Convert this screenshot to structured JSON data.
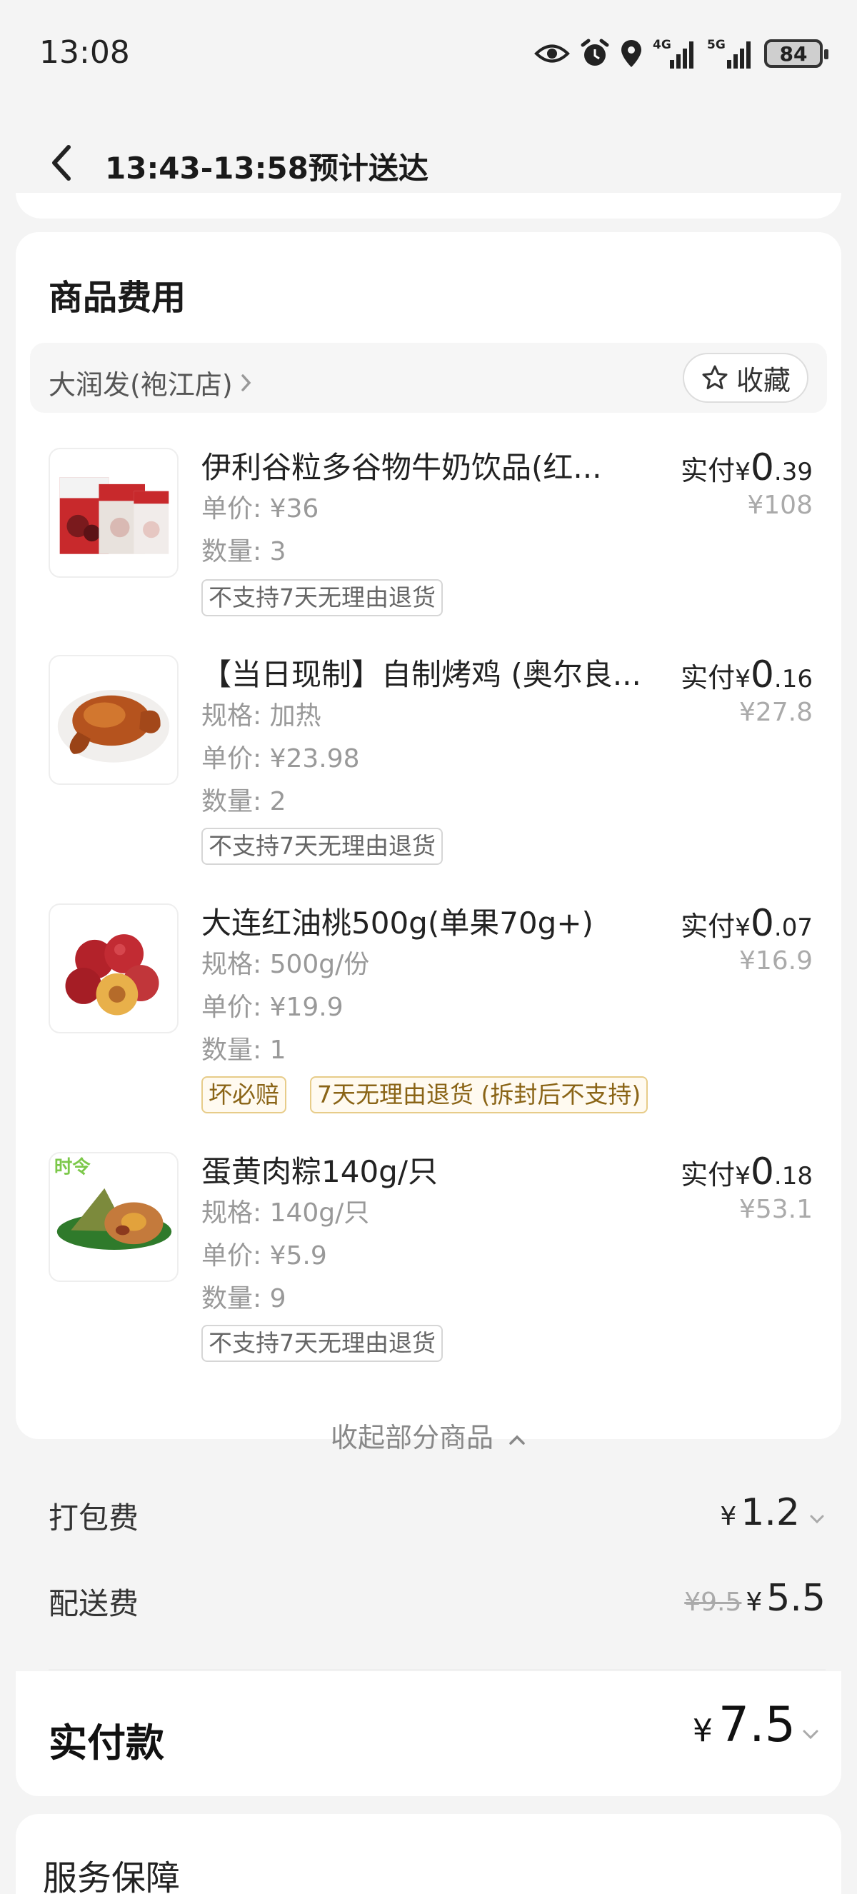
{
  "status_bar": {
    "time": "13:08",
    "battery": "84",
    "signal_labels": [
      "4G",
      "5G"
    ]
  },
  "nav": {
    "title": "13:43-13:58预计送达"
  },
  "fees_card": {
    "title": "商品费用",
    "store": {
      "name": "大润发(袍江店)",
      "favorite_label": "收藏"
    },
    "items": [
      {
        "name": "伊利谷粒多谷物牛奶饮品(红...",
        "meta": [
          "单价: ¥36",
          "数量: 3"
        ],
        "tags": [
          {
            "text": "不支持7天无理由退货",
            "style": "gray"
          }
        ],
        "paid_label": "实付",
        "paid_currency": "¥",
        "paid_int": "0",
        "paid_dec": ".39",
        "original": "¥108",
        "thumb_icon": "milk-box-icon"
      },
      {
        "name": "【当日现制】自制烤鸡 (奥尔良...",
        "meta": [
          "规格: 加热",
          "单价: ¥23.98",
          "数量: 2"
        ],
        "tags": [
          {
            "text": "不支持7天无理由退货",
            "style": "gray"
          }
        ],
        "paid_label": "实付",
        "paid_currency": "¥",
        "paid_int": "0",
        "paid_dec": ".16",
        "original": "¥27.8",
        "thumb_icon": "roast-chicken-icon"
      },
      {
        "name": "大连红油桃500g(单果70g+)",
        "meta": [
          "规格: 500g/份",
          "单价: ¥19.9",
          "数量: 1"
        ],
        "tags": [
          {
            "text": "坏必赔",
            "style": "gold"
          },
          {
            "text": "7天无理由退货 (拆封后不支持)",
            "style": "gold"
          }
        ],
        "paid_label": "实付",
        "paid_currency": "¥",
        "paid_int": "0",
        "paid_dec": ".07",
        "original": "¥16.9",
        "thumb_icon": "nectarine-icon"
      },
      {
        "name": "蛋黄肉粽140g/只",
        "meta": [
          "规格: 140g/只",
          "单价: ¥5.9",
          "数量: 9"
        ],
        "tags": [
          {
            "text": "不支持7天无理由退货",
            "style": "gray"
          }
        ],
        "paid_label": "实付",
        "paid_currency": "¥",
        "paid_int": "0",
        "paid_dec": ".18",
        "original": "¥53.1",
        "thumb_icon": "zongzi-icon",
        "thumb_badge": "时令"
      }
    ],
    "collapse_label": "收起部分商品",
    "packing_fee": {
      "label": "打包费",
      "currency": "¥",
      "value": "1.2"
    },
    "delivery_fee": {
      "label": "配送费",
      "original": "¥9.5",
      "currency": "¥",
      "value": "5.5"
    },
    "total": {
      "label": "实付款",
      "currency": "¥",
      "value": "7.5"
    }
  },
  "service_card": {
    "title": "服务保障"
  },
  "colors": {
    "background": "#f4f4f4",
    "card": "#ffffff",
    "tag_gold_border": "#e7cc89",
    "tag_gold_text": "#8a6416"
  }
}
